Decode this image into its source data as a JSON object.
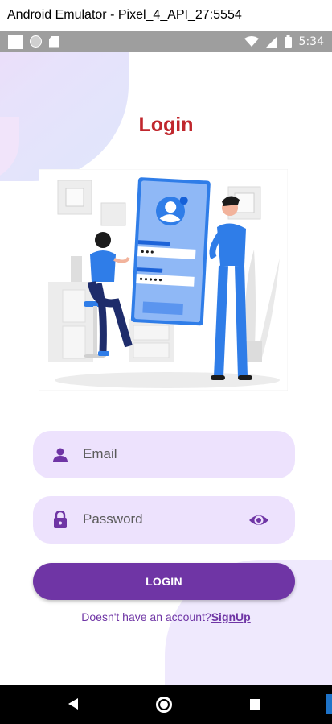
{
  "window": {
    "title": "Android Emulator - Pixel_4_API_27:5554"
  },
  "statusbar": {
    "time": "5:34"
  },
  "screen": {
    "title": "Login",
    "email": {
      "placeholder": "Email"
    },
    "password": {
      "placeholder": "Password"
    },
    "login_button": "LOGIN",
    "signup_prompt": "Doesn't have an account?",
    "signup_link": "SignUp"
  },
  "colors": {
    "title": "#c0272d",
    "accent": "#6f35a5",
    "field_bg": "#ede2fd"
  },
  "icons": {
    "email_field": "person-icon",
    "password_field": "lock-icon",
    "password_toggle": "eye-icon"
  }
}
